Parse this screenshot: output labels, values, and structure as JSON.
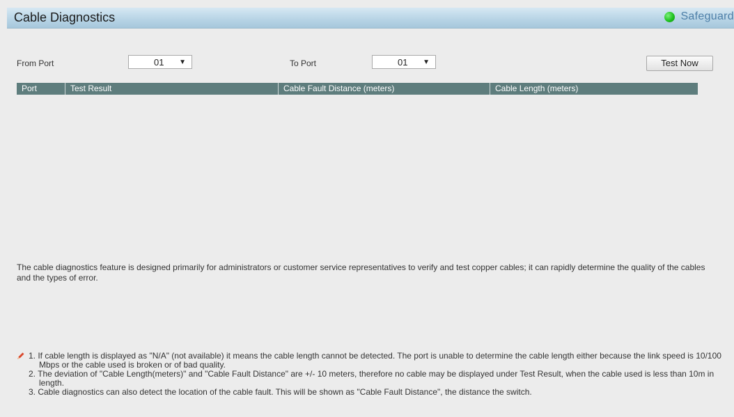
{
  "header": {
    "title": "Cable Diagnostics",
    "safeguard_label": "Safeguard",
    "safeguard_color": "#1fc21f"
  },
  "controls": {
    "from_port_label": "From Port",
    "from_port_value": "01",
    "to_port_label": "To Port",
    "to_port_value": "01",
    "test_button": "Test Now"
  },
  "table": {
    "columns": [
      "Port",
      "Test Result",
      "Cable Fault Distance (meters)",
      "Cable Length (meters)"
    ],
    "header_color": "#5e7d7d",
    "rows": []
  },
  "description": "The cable diagnostics feature is designed primarily for administrators or customer service representatives to verify and test copper cables; it can rapidly determine the quality of the cables and the types of error.",
  "notes": [
    "1. If cable length is displayed as \"N/A\" (not available) it means the cable length cannot be detected. The port is unable to determine the cable length either because the link speed is 10/100 Mbps or the cable used is broken or of bad quality.",
    "2. The deviation of \"Cable Length(meters)\" and \"Cable Fault Distance\" are +/- 10 meters, therefore no cable may be displayed under Test Result, when the cable used is less than 10m in length.",
    "3. Cable diagnostics can also detect the location of the cable fault. This will be shown as \"Cable Fault Distance\", the distance the switch."
  ],
  "icons": {
    "note": "pencil-icon",
    "status": "status-indicator-icon",
    "dropdown": "chevron-down-icon"
  }
}
